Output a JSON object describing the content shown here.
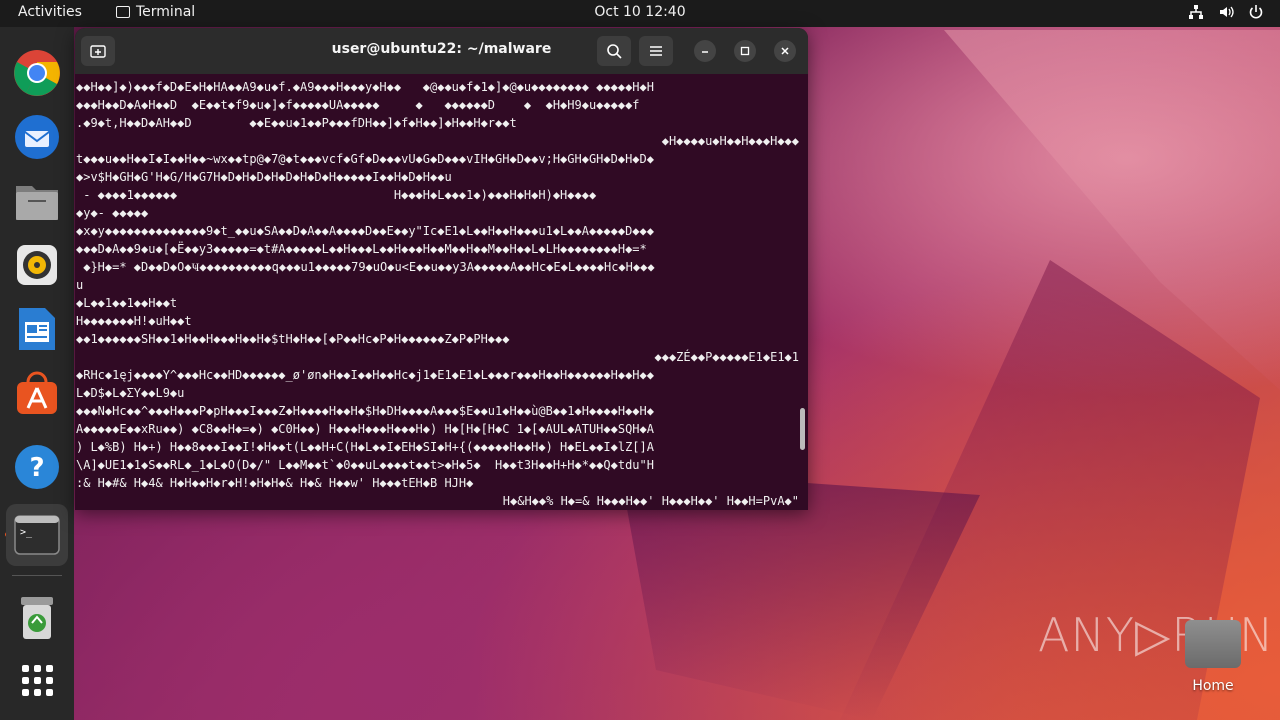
{
  "topbar": {
    "activities": "Activities",
    "app_name": "Terminal",
    "clock": "Oct 10  12:40"
  },
  "dock": {
    "apps": [
      "chrome",
      "thunderbird",
      "files",
      "rhythmbox",
      "libreoffice-writer",
      "app-center",
      "help",
      "terminal",
      "trash",
      "show-apps"
    ]
  },
  "window": {
    "title": "user@ubuntu22: ~/malware",
    "lines": [
      {
        "text": "◆◆H◆◆]◆)◆◆◆f◆D◆E◆H◆HA◆◆A9◆u◆f.◆A9◆◆◆H◆◆◆y◆H◆◆   ◆@◆◆u◆f◆1◆]◆@◆u◆◆◆◆◆◆◆◆ ◆◆◆◆◆H◆H",
        "align": "left"
      },
      {
        "text": "◆◆◆H◆◆D◆A◆H◆◆D  ◆E◆◆t◆f9◆u◆]◆f◆◆◆◆◆UA◆◆◆◆◆     ◆   ◆◆◆◆◆◆D    ◆  ◆H◆H9◆u◆◆◆◆◆f",
        "align": "left"
      },
      {
        "text": ".◆9◆t,H◆◆D◆AH◆◆D        ◆◆E◆◆u◆1◆◆P◆◆◆fDH◆◆]◆f◆H◆◆]◆H◆◆H◆r◆◆t",
        "align": "left"
      },
      {
        "text": "◆H◆◆◆◆u◆H◆◆H◆◆◆H◆◆◆",
        "align": "right"
      },
      {
        "text": "t◆◆◆u◆◆H◆◆I◆I◆◆H◆◆~wx◆◆tp@◆7@◆t◆◆◆vcf◆Gf◆D◆◆◆vU◆G◆D◆◆◆vIH◆GH◆D◆◆v;H◆GH◆GH◆D◆H◆D◆",
        "align": "left"
      },
      {
        "text": "◆>v$H◆GH◆G'H◆G/H◆G7H◆D◆H◆D◆H◆D◆H◆D◆H◆◆◆◆◆I◆◆H◆D◆H◆◆u",
        "align": "left"
      },
      {
        "text": " - ◆◆◆◆1◆◆◆◆◆◆                              H◆◆◆H◆L◆◆◆1◆)◆◆◆H◆H◆H)◆H◆◆◆◆",
        "align": "left"
      },
      {
        "text": "◆y◆- ◆◆◆◆◆",
        "align": "left"
      },
      {
        "text": "◆x◆y◆◆◆◆◆◆◆◆◆◆◆◆◆◆9◆t_◆◆u◆SA◆◆D◆A◆◆A◆◆◆◆D◆◆E◆◆y\"Ic◆E1◆L◆◆H◆◆H◆◆◆u1◆L◆◆A◆◆◆◆◆D◆◆◆",
        "align": "left"
      },
      {
        "text": "◆◆◆D◆A◆◆9◆u◆[◆Ë◆◆y3◆◆◆◆◆=◆t#A◆◆◆◆◆L◆◆H◆◆◆L◆◆H◆◆◆H◆◆M◆◆H◆◆M◆◆H◆◆L◆LH◆◆◆◆◆◆◆◆H◆=*",
        "align": "left"
      },
      {
        "text": " ◆}H◆=* ◆D◆◆D◆O◆Ҹ◆◆◆◆◆◆◆◆◆◆q◆◆◆u1◆◆◆◆◆79◆uO◆u<E◆◆u◆◆y3A◆◆◆◆◆A◆◆Hc◆E◆L◆◆◆◆Hc◆H◆◆◆",
        "align": "left"
      },
      {
        "text": "u",
        "align": "left"
      },
      {
        "text": "◆L◆◆1◆◆1◆◆H◆◆t",
        "align": "left"
      },
      {
        "text": "H◆◆◆◆◆◆◆H!◆uH◆◆t",
        "align": "left"
      },
      {
        "text": "◆◆1◆◆◆◆◆◆SH◆◆1◆H◆◆H◆◆◆H◆◆H◆$tH◆H◆◆[◆P◆◆Hc◆P◆H◆◆◆◆◆◆Z◆P◆PH◆◆◆",
        "align": "left"
      },
      {
        "text": "◆◆◆ZÉ◆◆P◆◆◆◆◆E1◆E1◆1",
        "align": "right"
      },
      {
        "text": "◆RHc◆1ęj◆◆◆◆Y^◆◆◆Hc◆◆HD◆◆◆◆◆◆_ø'øn◆H◆◆I◆◆H◆◆Hc◆j1◆E1◆E1◆L◆◆◆r◆◆◆H◆◆H◆◆◆◆◆◆H◆◆H◆◆",
        "align": "left"
      },
      {
        "text": "L◆D$◆L◆ΣY◆◆L9◆u",
        "align": "left"
      },
      {
        "text": "◆◆◆N◆Hc◆◆^◆◆◆H◆◆◆P◆pH◆◆◆I◆◆◆Z◆H◆◆◆◆H◆◆H◆$H◆DH◆◆◆◆A◆◆◆$E◆◆u1◆H◆◆ù@B◆◆1◆H◆◆◆◆H◆◆H◆",
        "align": "left"
      },
      {
        "text": "A◆◆◆◆◆E◆◆xRu◆◆) ◆C8◆◆H◆=◆) ◆C0H◆◆) H◆◆◆H◆◆◆H◆◆◆H◆) H◆[H◆[H◆C 1◆[◆AUL◆ATUH◆◆SQH◆A",
        "align": "left"
      },
      {
        "text": ") L◆%B) H◆+) H◆◆8◆◆◆I◆◆I!◆H◆◆t(L◆◆H+C(H◆L◆◆I◆EH◆SI◆H+{(◆◆◆◆◆H◆◆H◆) H◆EL◆◆I◆lZ[]A",
        "align": "left"
      },
      {
        "text": "\\A]◆UE1◆1◆S◆◆RL◆_1◆L◆O(D◆/\" L◆◆M◆◆t`◆0◆◆uL◆◆◆◆t◆◆t>◆H◆5◆  H◆◆t3H◆◆H+H◆*◆◆Q◆tdu\"H",
        "align": "left"
      },
      {
        "text": ":& H◆#& H◆4& H◆H◆◆H◆r◆H!◆H◆H◆& H◆& H◆◆w' H◆◆◆tEH◆B HJH◆",
        "align": "left"
      },
      {
        "text": "H◆&H◆◆% H◆=& H◆◆◆H◆◆' H◆◆◆H◆◆' H◆◆H=PvA◆\"",
        "align": "right"
      }
    ]
  },
  "watermark": "ANY▷RUN",
  "desktop": {
    "home_label": "Home"
  },
  "colors": {
    "terminal_bg": "#300a24",
    "topbar_bg": "#1b1b1b",
    "dock_bg": "#282828",
    "accent": "#e95420"
  }
}
